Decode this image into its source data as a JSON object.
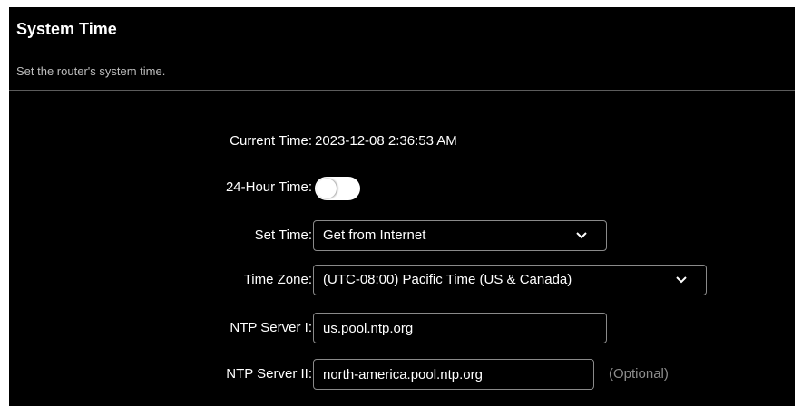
{
  "header": {
    "title": "System Time",
    "subtitle": "Set the router's system time."
  },
  "form": {
    "current_time": {
      "label": "Current Time:",
      "value": "2023-12-08 2:36:53 AM"
    },
    "hour24": {
      "label": "24-Hour Time:",
      "enabled": false
    },
    "set_time": {
      "label": "Set Time:",
      "value": "Get from Internet"
    },
    "time_zone": {
      "label": "Time Zone:",
      "value": "(UTC-08:00) Pacific Time (US & Canada)"
    },
    "ntp1": {
      "label": "NTP Server I:",
      "value": "us.pool.ntp.org"
    },
    "ntp2": {
      "label": "NTP Server II:",
      "value": "north-america.pool.ntp.org",
      "hint": "(Optional)"
    }
  },
  "colors": {
    "background": "#000000",
    "text": "#ffffff",
    "muted": "#8d8d8d",
    "border": "#8a8a8a"
  },
  "icons": {
    "dropdown": "chevron-down-icon"
  }
}
